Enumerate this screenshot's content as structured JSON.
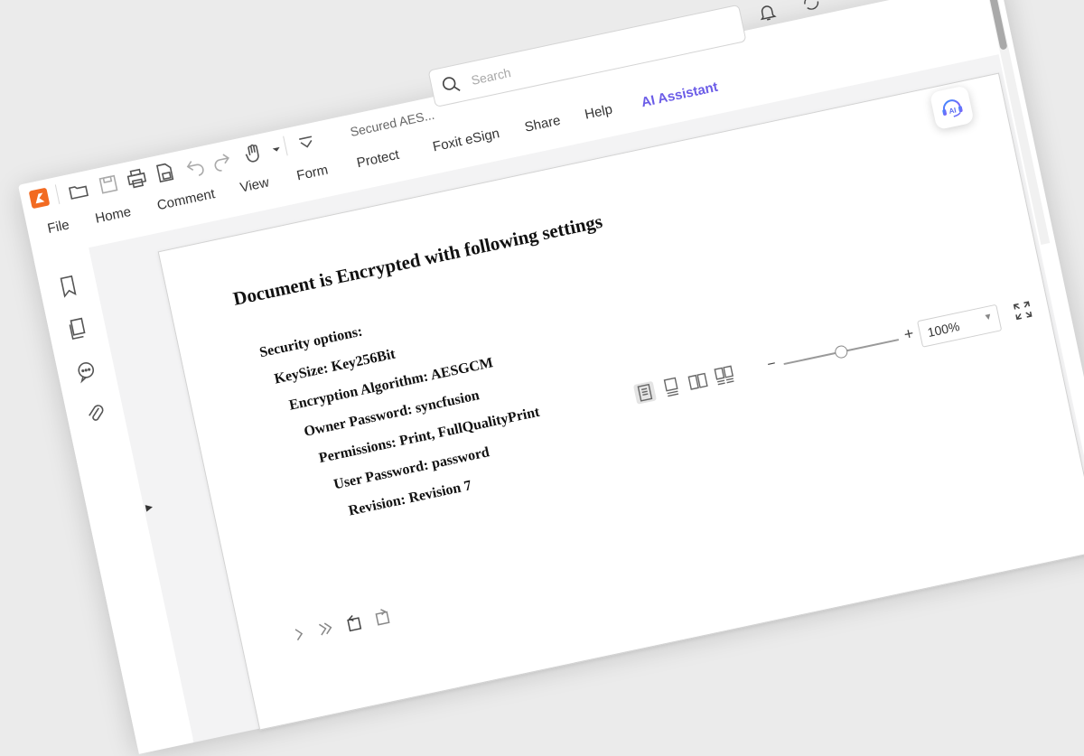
{
  "toolbar": {
    "file_title": "Secured AES...",
    "search_placeholder": "Search"
  },
  "menu": {
    "tabs": [
      {
        "label": "File"
      },
      {
        "label": "Home"
      },
      {
        "label": "Comment"
      },
      {
        "label": "View"
      },
      {
        "label": "Form"
      },
      {
        "label": "Protect"
      },
      {
        "label": "Foxit eSign"
      },
      {
        "label": "Share"
      },
      {
        "label": "Help"
      },
      {
        "label": "AI Assistant"
      }
    ]
  },
  "document": {
    "title": "Document is Encrypted with following settings",
    "lines": [
      "Security options:",
      "KeySize: Key256Bit",
      "Encryption Algorithm: AESGCM",
      "Owner Password: syncfusion",
      "Permissions: Print, FullQualityPrint",
      "User Password: password",
      "Revision: Revision 7"
    ]
  },
  "ai_fab": {
    "label": "AI"
  },
  "status": {
    "zoom": "100%",
    "zoom_level": 0.5
  },
  "colors": {
    "brand": "#f26a21",
    "ai_accent": "#6b5ce7"
  }
}
